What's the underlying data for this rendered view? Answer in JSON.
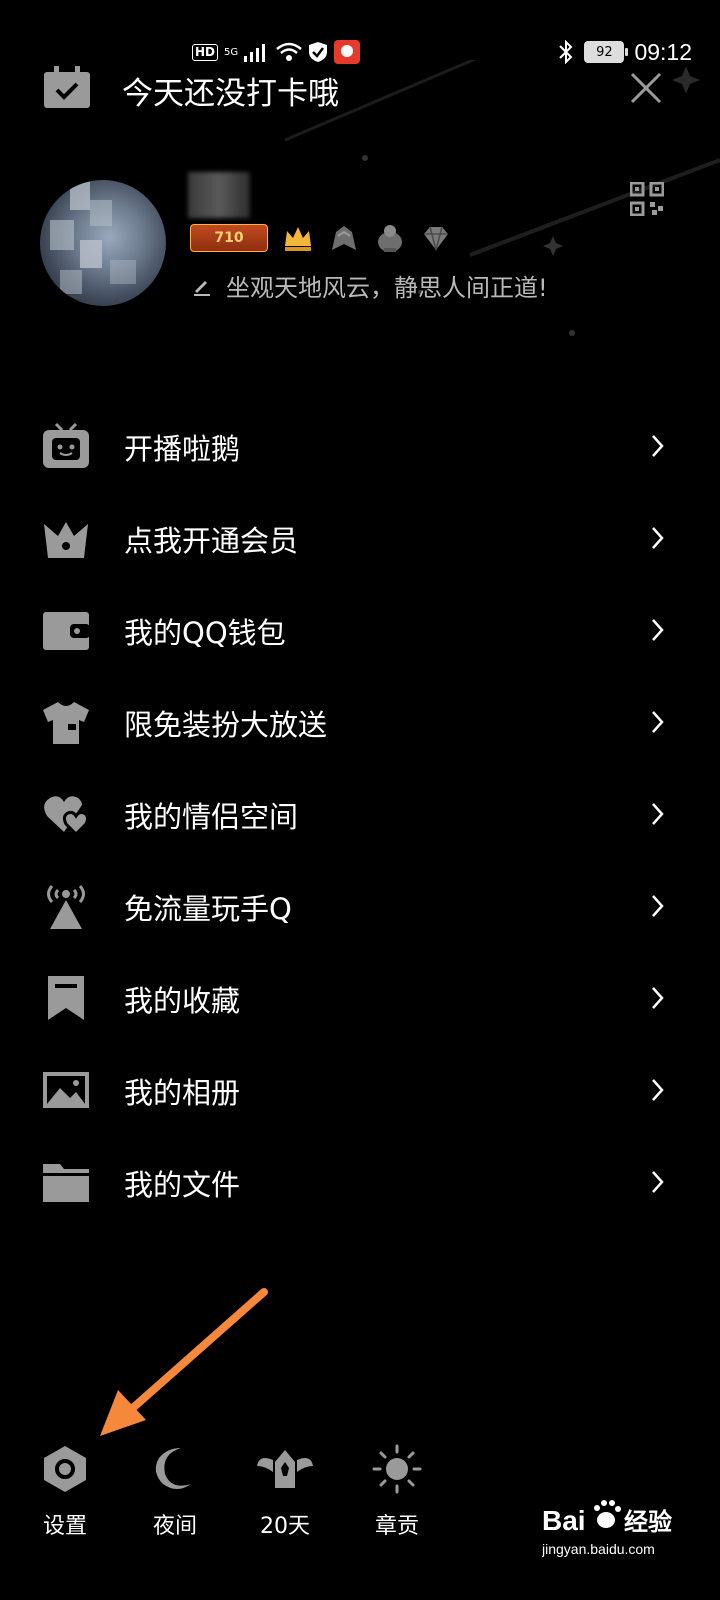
{
  "status_bar": {
    "left_indicators": [
      "HD",
      "5G"
    ],
    "battery": "92",
    "time": "09:12"
  },
  "header": {
    "title": "今天还没打卡哦"
  },
  "profile": {
    "level": "710",
    "signature": "坐观天地风云，静思人间正道!"
  },
  "menu": {
    "items": [
      {
        "label": "开播啦鹅",
        "icon": "tv-icon"
      },
      {
        "label": "点我开通会员",
        "icon": "crown-icon"
      },
      {
        "label": "我的QQ钱包",
        "icon": "wallet-icon"
      },
      {
        "label": "限免装扮大放送",
        "icon": "tshirt-icon"
      },
      {
        "label": "我的情侣空间",
        "icon": "hearts-icon"
      },
      {
        "label": "免流量玩手Q",
        "icon": "antenna-icon"
      },
      {
        "label": "我的收藏",
        "icon": "bookmark-icon"
      },
      {
        "label": "我的相册",
        "icon": "photo-icon"
      },
      {
        "label": "我的文件",
        "icon": "folder-icon"
      }
    ]
  },
  "bottom_bar": {
    "items": [
      {
        "label": "设置",
        "icon": "settings-hexagon-icon"
      },
      {
        "label": "夜间",
        "icon": "moon-icon"
      },
      {
        "label": "20天",
        "icon": "winged-badge-icon"
      },
      {
        "label": "章贡",
        "icon": "sun-icon"
      }
    ]
  },
  "watermark": {
    "brand": "Bai",
    "brand_cn": "经验",
    "url": "jingyan.baidu.com"
  },
  "colors": {
    "background": "#000000",
    "icon_gray": "#9a9a9a",
    "arrow": "#f5883a",
    "text": "#ffffff"
  }
}
